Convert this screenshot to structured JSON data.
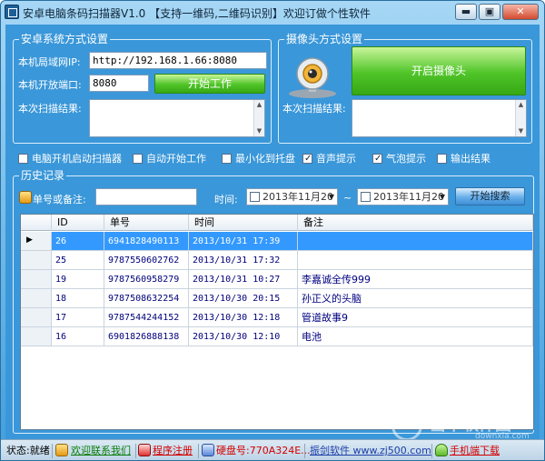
{
  "window": {
    "title": "安卓电脑条码扫描器V1.0 【支持一维码,二维码识别】欢迎订做个性软件",
    "min_glyph": "▬",
    "max_glyph": "▣",
    "close_glyph": "✕"
  },
  "android_group": {
    "title": "安卓系统方式设置",
    "ip_label": "本机局域网IP:",
    "ip_value": "http://192.168.1.66:8080",
    "port_label": "本机开放端口:",
    "port_value": "8080",
    "start_button": "开始工作",
    "result_label": "本次扫描结果:"
  },
  "camera_group": {
    "title": "摄像头方式设置",
    "open_button": "开启摄像头",
    "result_label": "本次扫描结果:"
  },
  "options": [
    {
      "label": "电脑开机启动扫描器",
      "checked": false
    },
    {
      "label": "自动开始工作",
      "checked": false
    },
    {
      "label": "最小化到托盘",
      "checked": false
    },
    {
      "label": "音声提示",
      "checked": true
    },
    {
      "label": "气泡提示",
      "checked": true
    },
    {
      "label": "输出结果",
      "checked": false
    }
  ],
  "history": {
    "title": "历史记录",
    "search_label": "单号或备注:",
    "time_label": "时间:",
    "date_from": "2013年11月20",
    "tilde": "~",
    "date_to": "2013年11月20",
    "search_button": "开始搜索",
    "columns": [
      "ID",
      "单号",
      "时间",
      "备注"
    ],
    "rows": [
      {
        "id": "26",
        "code": "6941828490113",
        "time": "2013/10/31 17:39",
        "note": "",
        "selected": true
      },
      {
        "id": "25",
        "code": "9787550602762",
        "time": "2013/10/31 17:32",
        "note": ""
      },
      {
        "id": "19",
        "code": "9787560958279",
        "time": "2013/10/31 10:27",
        "note": "李嘉诚全传999"
      },
      {
        "id": "18",
        "code": "9787508632254",
        "time": "2013/10/30 20:15",
        "note": "孙正义的头脑"
      },
      {
        "id": "17",
        "code": "9787544244152",
        "time": "2013/10/30 12:18",
        "note": "管道故事9"
      },
      {
        "id": "16",
        "code": "6901826888138",
        "time": "2013/10/30 12:10",
        "note": "电池"
      }
    ]
  },
  "status": {
    "state": "状态:就绪",
    "contact": "欢迎联系我们",
    "register": "程序注册",
    "disk": "硬盘号:770A324E...",
    "site": "振剑软件 www.zj500.com",
    "mobile": "手机端下载",
    "colors": {
      "green": "#0b7d0b",
      "red": "#d40000",
      "blue": "#1f3fa8"
    }
  },
  "watermark": {
    "text": "当下软件园",
    "sub": "downxia.com"
  }
}
